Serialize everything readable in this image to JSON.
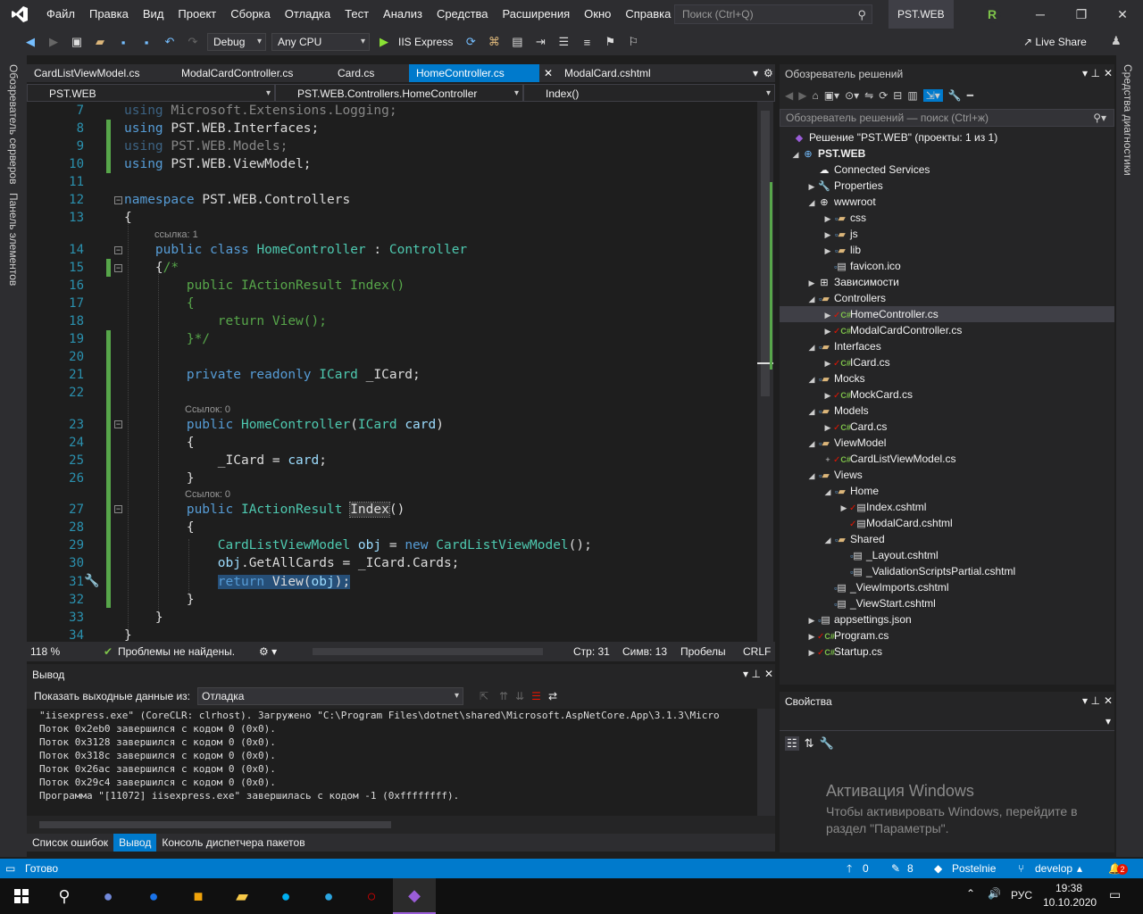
{
  "menubar": {
    "items": [
      "Файл",
      "Правка",
      "Вид",
      "Проект",
      "Сборка",
      "Отладка",
      "Тест",
      "Анализ",
      "Средства",
      "Расширения",
      "Окно",
      "Справка"
    ],
    "search_placeholder": "Поиск (Ctrl+Q)",
    "solution_name": "PST.WEB",
    "user_initial": "R"
  },
  "toolbar": {
    "config": "Debug",
    "platform": "Any CPU",
    "run_target": "IIS Express",
    "live_share": "Live Share"
  },
  "left_strip": {
    "server_explorer": "Обозреватель серверов",
    "toolbox": "Панель элементов"
  },
  "right_strip": {
    "diagnostics": "Средства диагностики"
  },
  "tabs": [
    "CardListViewModel.cs",
    "ModalCardController.cs",
    "Card.cs",
    "HomeController.cs",
    "ModalCard.cshtml"
  ],
  "nav": {
    "project": "PST.WEB",
    "class": "PST.WEB.Controllers.HomeController",
    "member": "Index()"
  },
  "code": {
    "line_numbers": [
      "7",
      "8",
      "9",
      "10",
      "11",
      "12",
      "13",
      "14",
      "15",
      "16",
      "17",
      "18",
      "19",
      "20",
      "21",
      "22",
      "23",
      "24",
      "25",
      "26",
      "27",
      "28",
      "29",
      "30",
      "31",
      "32",
      "33",
      "34"
    ],
    "ref1": "ссылка: 1",
    "ref2": "Ссылок: 0",
    "ref3": "Ссылок: 0"
  },
  "editor_status": {
    "zoom": "118 %",
    "issues": "Проблемы не найдены.",
    "line": "Стр: 31",
    "col": "Симв: 13",
    "whitespace": "Пробелы",
    "eol": "CRLF"
  },
  "output": {
    "title": "Вывод",
    "show_from_label": "Показать выходные данные из:",
    "source": "Отладка",
    "lines": [
      "\"iisexpress.exe\" (CoreCLR: clrhost). Загружено \"C:\\Program Files\\dotnet\\shared\\Microsoft.AspNetCore.App\\3.1.3\\Micro",
      "Поток 0x2eb0 завершился с кодом 0 (0x0).",
      "Поток 0x3128 завершился с кодом 0 (0x0).",
      "Поток 0x318c завершился с кодом 0 (0x0).",
      "Поток 0x26ac завершился с кодом 0 (0x0).",
      "Поток 0x29c4 завершился с кодом 0 (0x0).",
      "Программа \"[11072] iisexpress.exe\" завершилась с кодом -1 (0xffffffff)."
    ],
    "tabs": [
      "Список ошибок",
      "Вывод",
      "Консоль диспетчера пакетов"
    ]
  },
  "solution_explorer": {
    "title": "Обозреватель решений",
    "search_placeholder": "Обозреватель решений — поиск (Ctrl+ж)",
    "nodes": [
      {
        "label": "Решение \"PST.WEB\" (проекты: 1 из 1)"
      },
      {
        "label": "PST.WEB"
      },
      {
        "label": "Connected Services"
      },
      {
        "label": "Properties"
      },
      {
        "label": "wwwroot"
      },
      {
        "label": "css"
      },
      {
        "label": "js"
      },
      {
        "label": "lib"
      },
      {
        "label": "favicon.ico"
      },
      {
        "label": "Зависимости"
      },
      {
        "label": "Controllers"
      },
      {
        "label": "HomeController.cs"
      },
      {
        "label": "ModalCardController.cs"
      },
      {
        "label": "Interfaces"
      },
      {
        "label": "ICard.cs"
      },
      {
        "label": "Mocks"
      },
      {
        "label": "MockCard.cs"
      },
      {
        "label": "Models"
      },
      {
        "label": "Card.cs"
      },
      {
        "label": "ViewModel"
      },
      {
        "label": "CardListViewModel.cs"
      },
      {
        "label": "Views"
      },
      {
        "label": "Home"
      },
      {
        "label": "Index.cshtml"
      },
      {
        "label": "ModalCard.cshtml"
      },
      {
        "label": "Shared"
      },
      {
        "label": "_Layout.cshtml"
      },
      {
        "label": "_ValidationScriptsPartial.cshtml"
      },
      {
        "label": "_ViewImports.cshtml"
      },
      {
        "label": "_ViewStart.cshtml"
      },
      {
        "label": "appsettings.json"
      },
      {
        "label": "Program.cs"
      },
      {
        "label": "Startup.cs"
      }
    ]
  },
  "properties": {
    "title": "Свойства"
  },
  "watermark": {
    "title": "Активация Windows",
    "text": "Чтобы активировать Windows, перейдите в раздел \"Параметры\"."
  },
  "statusbar": {
    "ready": "Готово",
    "up": "0",
    "pencil": "8",
    "repo": "Postelnie",
    "branch": "develop",
    "notify": "2"
  },
  "taskbar": {
    "lang": "РУС",
    "time": "19:38",
    "date": "10.10.2020"
  },
  "colors": {
    "accent": "#007acc",
    "bg": "#1e1e1e",
    "chrome": "#2d2d30",
    "vs_purple": "#68217a"
  }
}
